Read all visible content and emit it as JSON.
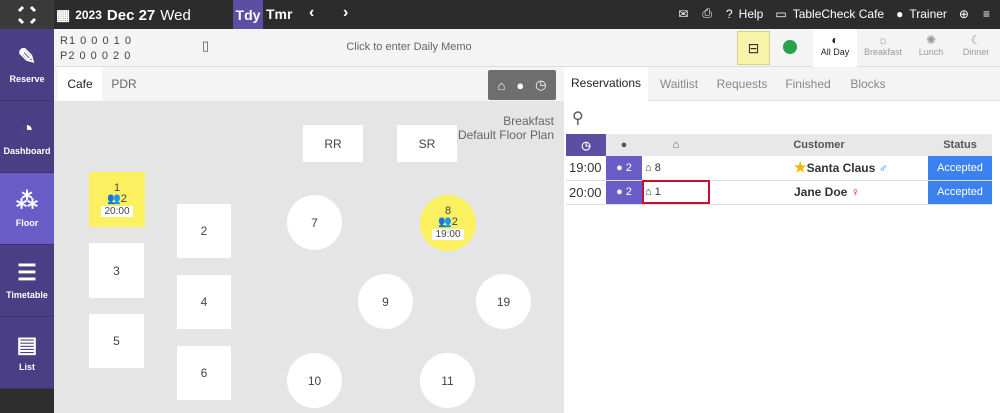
{
  "topbar": {
    "year": "2023",
    "date": "Dec 27",
    "weekday": "Wed",
    "today_label": "Tdy",
    "tomorrow_label": "Tmr",
    "help_label": "Help",
    "venue_label": "TableCheck Cafe",
    "user_label": "Trainer"
  },
  "sidebar": {
    "items": [
      {
        "label": "Reserve",
        "icon": "edit-icon"
      },
      {
        "label": "Dashboard",
        "icon": "speedometer-icon"
      },
      {
        "label": "Floor",
        "icon": "floor-icon"
      },
      {
        "label": "Timetable",
        "icon": "timetable-icon"
      },
      {
        "label": "List",
        "icon": "list-icon"
      }
    ],
    "active": "Floor"
  },
  "status": {
    "row1": "R1  0  0   0  1  0",
    "row2": "P2  0  0   0  2  0",
    "memo_placeholder": "Click to enter Daily Memo"
  },
  "meals": [
    {
      "label": "All Day",
      "active": true
    },
    {
      "label": "Breakfast",
      "active": false
    },
    {
      "label": "Lunch",
      "active": false
    },
    {
      "label": "Dinner",
      "active": false
    }
  ],
  "floor": {
    "tabs": [
      "Cafe",
      "PDR"
    ],
    "active_tab": "Cafe",
    "service": "Breakfast",
    "plan": "Default Floor Plan",
    "tables": [
      {
        "id": "1",
        "occupied": true,
        "pax": "2",
        "time": "20:00"
      },
      {
        "id": "2"
      },
      {
        "id": "3"
      },
      {
        "id": "4"
      },
      {
        "id": "5"
      },
      {
        "id": "6"
      },
      {
        "id": "7"
      },
      {
        "id": "8",
        "occupied": true,
        "pax": "2",
        "time": "19:00"
      },
      {
        "id": "9"
      },
      {
        "id": "10"
      },
      {
        "id": "11"
      },
      {
        "id": "19"
      },
      {
        "id": "RR"
      },
      {
        "id": "SR"
      }
    ]
  },
  "reservations": {
    "tabs": [
      "Reservations",
      "Waitlist",
      "Requests",
      "Finished",
      "Blocks"
    ],
    "active_tab": "Reservations",
    "headers": {
      "customer": "Customer",
      "status": "Status"
    },
    "rows": [
      {
        "time": "19:00",
        "pax": "2",
        "table": "8",
        "customer": "Santa Claus",
        "status": "Accepted",
        "vip": true,
        "gender": "male"
      },
      {
        "time": "20:00",
        "pax": "2",
        "table": "1",
        "customer": "Jane Doe",
        "status": "Accepted",
        "vip": false,
        "gender": "female"
      }
    ]
  },
  "colors": {
    "brand": "#5b4ea3",
    "accent": "#6a5cc7",
    "occupied": "#fbf060",
    "accepted": "#3b82f0",
    "topbar": "#2c2c2c"
  }
}
